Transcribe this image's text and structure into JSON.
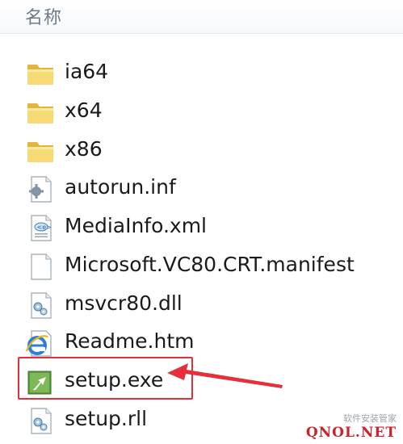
{
  "header": {
    "column_name": "名称"
  },
  "files": [
    {
      "name": "ia64",
      "icon": "folder-icon"
    },
    {
      "name": "x64",
      "icon": "folder-icon"
    },
    {
      "name": "x86",
      "icon": "folder-icon"
    },
    {
      "name": "autorun.inf",
      "icon": "settings-file-icon"
    },
    {
      "name": "MediaInfo.xml",
      "icon": "xml-file-icon"
    },
    {
      "name": "Microsoft.VC80.CRT.manifest",
      "icon": "blank-file-icon"
    },
    {
      "name": "msvcr80.dll",
      "icon": "dll-file-icon"
    },
    {
      "name": "Readme.htm",
      "icon": "ie-file-icon"
    },
    {
      "name": "setup.exe",
      "icon": "exe-file-icon"
    },
    {
      "name": "setup.rll",
      "icon": "dll-file-icon"
    }
  ],
  "annotation": {
    "highlighted_file": "setup.exe",
    "color": "#e52f3b"
  },
  "watermark": {
    "line1": "软件安装管家",
    "line2": "QNOL.NET"
  }
}
